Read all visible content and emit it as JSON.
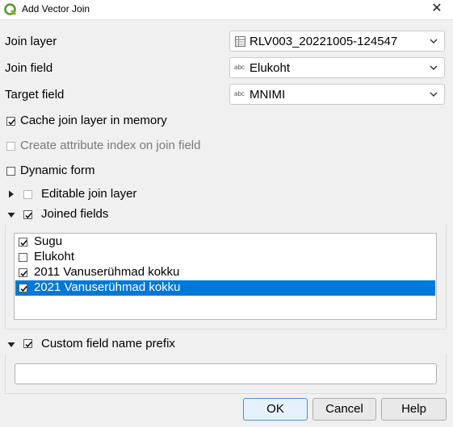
{
  "window": {
    "title": "Add Vector Join",
    "close_glyph": "✕",
    "app_icon": "qgis-icon"
  },
  "form": {
    "join_layer_label": "Join layer",
    "join_layer_value": "RLV003_20221005-124547",
    "join_layer_icon": "table-icon",
    "join_field_label": "Join field",
    "join_field_value": "Elukoht",
    "join_field_type": "abc",
    "target_field_label": "Target field",
    "target_field_value": "MNIMI",
    "target_field_type": "abc"
  },
  "options": {
    "cache_label": "Cache join layer in memory",
    "cache_checked": true,
    "attr_index_label": "Create attribute index on join field",
    "attr_index_checked": false,
    "attr_index_enabled": false,
    "dynamic_form_label": "Dynamic form",
    "dynamic_form_checked": false
  },
  "editable": {
    "label": "Editable join layer",
    "checked": false,
    "expanded": false
  },
  "joined_fields": {
    "label": "Joined fields",
    "checked": true,
    "expanded": true,
    "items": [
      {
        "label": "Sugu",
        "checked": true,
        "selected": false
      },
      {
        "label": "Elukoht",
        "checked": false,
        "selected": false
      },
      {
        "label": "2011 Vanuserühmad kokku",
        "checked": true,
        "selected": false
      },
      {
        "label": "2021 Vanuserühmad kokku",
        "checked": true,
        "selected": true
      }
    ]
  },
  "prefix": {
    "label": "Custom field name prefix",
    "checked": true,
    "expanded": true,
    "value": ""
  },
  "buttons": {
    "ok": "OK",
    "cancel": "Cancel",
    "help": "Help"
  },
  "colors": {
    "selection": "#0078d7",
    "background": "#f0f0f0"
  }
}
